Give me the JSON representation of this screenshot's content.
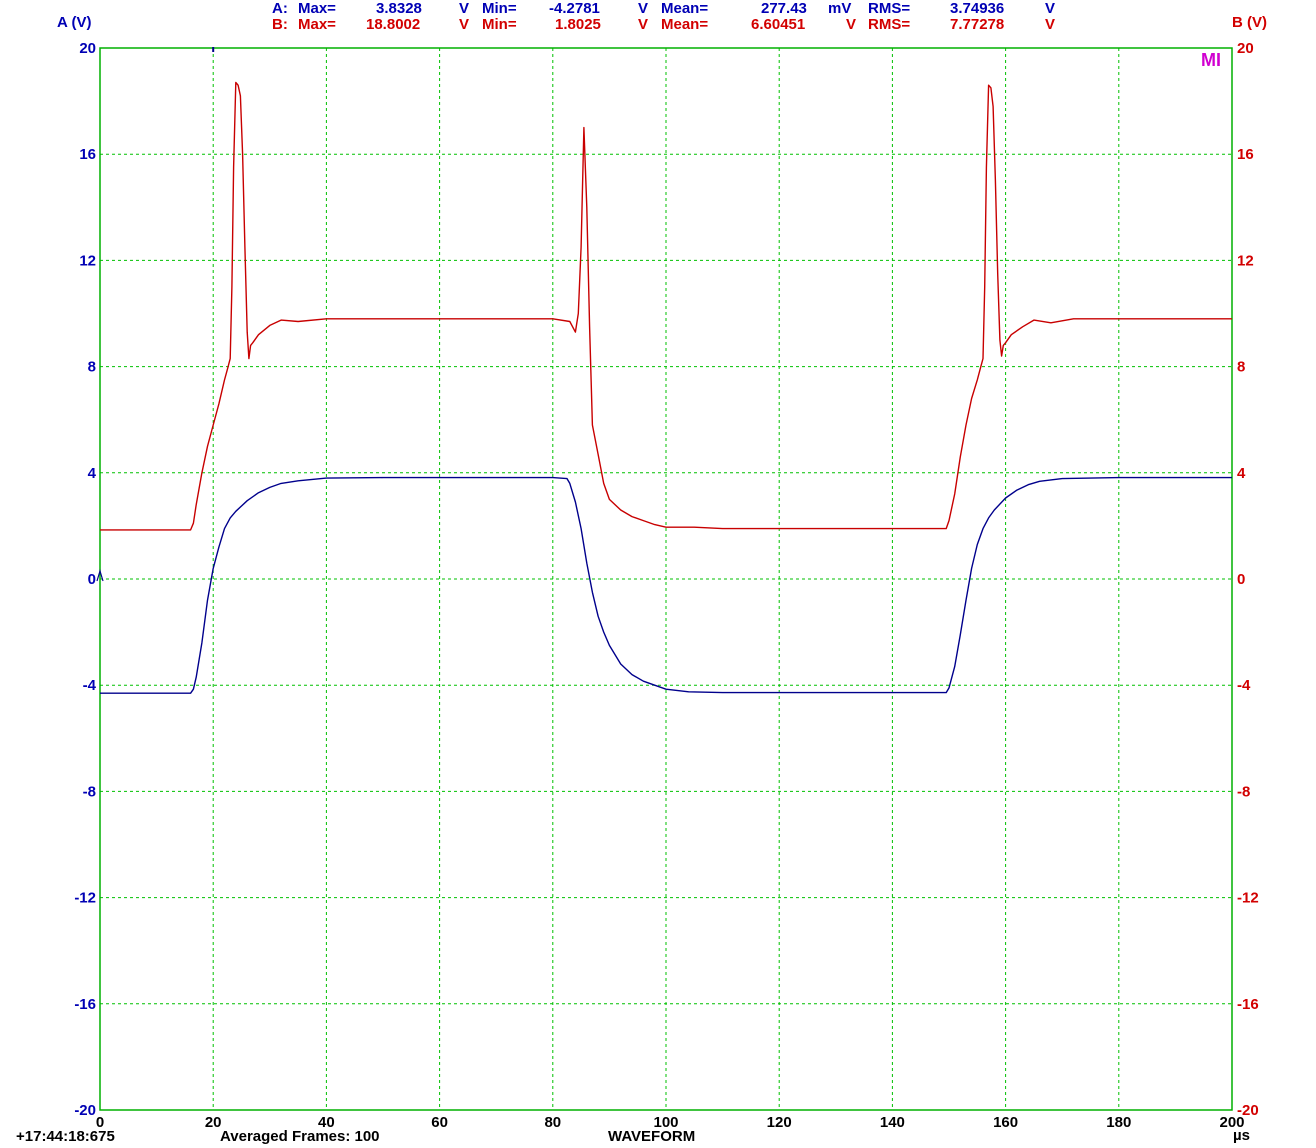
{
  "measurements": {
    "a": {
      "prefix": "A:",
      "max_label": "Max=",
      "max_value": "3.8328",
      "max_unit": "V",
      "min_label": "Min=",
      "min_value": "-4.2781",
      "min_unit": "V",
      "mean_label": "Mean=",
      "mean_value": "277.43",
      "mean_unit": "mV",
      "rms_label": "RMS=",
      "rms_value": "3.74936",
      "rms_unit": "V"
    },
    "b": {
      "prefix": "B:",
      "max_label": "Max=",
      "max_value": "18.8002",
      "max_unit": "V",
      "min_label": "Min=",
      "min_value": "1.8025",
      "min_unit": "V",
      "mean_label": "Mean=",
      "mean_value": "6.60451",
      "mean_unit": "V",
      "rms_label": "RMS=",
      "rms_value": "7.77278",
      "rms_unit": "V"
    }
  },
  "axis_titles": {
    "left": "A (V)",
    "right": "B (V)"
  },
  "footer": {
    "timestamp": "+17:44:18:675",
    "frames": "Averaged Frames: 100",
    "mode": "WAVEFORM",
    "x_unit": "µs"
  },
  "marker": "MI",
  "colors": {
    "channel_a": "#00008c",
    "channel_b": "#c80000",
    "grid": "#00c000",
    "plot_border": "#00b000",
    "marker": "#d000d0"
  },
  "chart_data": {
    "type": "line",
    "xlim": [
      0,
      200
    ],
    "ylim": [
      -20,
      20
    ],
    "y2lim": [
      -20,
      20
    ],
    "grid": true,
    "x_ticks": [
      0,
      20,
      40,
      60,
      80,
      100,
      120,
      140,
      160,
      180,
      200
    ],
    "y_ticks": [
      20,
      16,
      12,
      8,
      4,
      0,
      -4,
      -8,
      -12,
      -16,
      -20
    ],
    "y2_ticks": [
      20,
      16,
      12,
      8,
      4,
      0,
      -4,
      -8,
      -12,
      -16,
      -20
    ],
    "series": [
      {
        "name": "A",
        "axis": "left",
        "x": [
          0,
          16,
          16.5,
          17,
          18,
          19,
          20,
          21,
          22,
          23,
          24,
          25,
          26,
          28,
          30,
          32,
          35,
          40,
          50,
          60,
          70,
          80,
          82.5,
          83,
          84,
          85,
          86,
          87,
          88,
          89,
          90,
          92,
          94,
          96,
          98,
          100,
          104,
          110,
          120,
          130,
          140,
          149.5,
          150,
          151,
          152,
          153,
          154,
          155,
          156,
          157,
          158,
          160,
          162,
          164,
          166,
          170,
          180,
          190,
          200
        ],
        "y": [
          -4.3,
          -4.3,
          -4.15,
          -3.7,
          -2.4,
          -0.8,
          0.4,
          1.2,
          1.9,
          2.3,
          2.55,
          2.75,
          2.95,
          3.25,
          3.45,
          3.6,
          3.7,
          3.8,
          3.82,
          3.82,
          3.82,
          3.82,
          3.78,
          3.6,
          2.9,
          1.9,
          0.6,
          -0.5,
          -1.4,
          -2.0,
          -2.5,
          -3.2,
          -3.6,
          -3.85,
          -4.0,
          -4.15,
          -4.25,
          -4.28,
          -4.28,
          -4.28,
          -4.28,
          -4.28,
          -4.1,
          -3.3,
          -2.1,
          -0.8,
          0.4,
          1.3,
          1.9,
          2.3,
          2.6,
          3.05,
          3.35,
          3.55,
          3.68,
          3.78,
          3.82,
          3.82,
          3.82
        ]
      },
      {
        "name": "B",
        "axis": "right",
        "x": [
          0,
          16,
          16.5,
          17,
          18,
          19,
          20,
          21,
          22,
          22.5,
          23,
          23.3,
          23.6,
          24,
          24.4,
          24.8,
          25.2,
          25.6,
          26,
          26.3,
          26.6,
          27,
          28,
          30,
          32,
          35,
          40,
          50,
          60,
          70,
          80,
          83,
          84,
          84.5,
          85,
          85.5,
          86,
          86.5,
          87,
          88,
          89,
          90,
          92,
          94,
          96,
          98,
          100,
          105,
          110,
          115,
          120,
          130,
          140,
          149.5,
          150,
          151,
          152,
          153,
          154,
          155,
          155.5,
          156,
          156.3,
          156.6,
          157,
          157.4,
          157.8,
          158.2,
          158.6,
          159,
          159.3,
          159.6,
          160,
          161,
          163,
          165,
          168,
          172,
          180,
          190,
          200
        ],
        "y": [
          1.85,
          1.85,
          2.1,
          2.8,
          4.0,
          5.0,
          5.8,
          6.6,
          7.5,
          7.9,
          8.3,
          11.0,
          15.5,
          18.7,
          18.6,
          18.2,
          16.0,
          12.5,
          9.3,
          8.3,
          8.8,
          8.9,
          9.2,
          9.55,
          9.75,
          9.7,
          9.8,
          9.8,
          9.8,
          9.8,
          9.8,
          9.7,
          9.3,
          10.0,
          12.5,
          17.0,
          14.0,
          9.5,
          5.8,
          4.7,
          3.6,
          3.0,
          2.6,
          2.35,
          2.2,
          2.05,
          1.95,
          1.95,
          1.9,
          1.9,
          1.9,
          1.9,
          1.9,
          1.9,
          2.2,
          3.2,
          4.6,
          5.8,
          6.8,
          7.5,
          7.9,
          8.3,
          11.0,
          15.5,
          18.6,
          18.5,
          17.8,
          15.0,
          11.5,
          9.0,
          8.4,
          8.8,
          8.9,
          9.2,
          9.5,
          9.75,
          9.65,
          9.8,
          9.8,
          9.8,
          9.8
        ]
      }
    ]
  }
}
